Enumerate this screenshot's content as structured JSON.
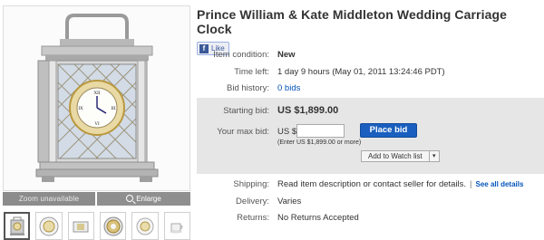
{
  "viewer": {
    "zoom_label": "Zoom unavailable",
    "enlarge_label": "Enlarge",
    "clock_numerals": [
      "XII",
      "III",
      "VI",
      "IX"
    ]
  },
  "listing": {
    "title": "Prince William & Kate Middleton Wedding Carriage Clock",
    "like_label": "Like",
    "condition_label": "Item condition:",
    "condition_value": "New",
    "time_left_label": "Time left:",
    "time_left_value": "1 day 9 hours (May 01, 2011 13:24:46 PDT)",
    "bid_history_label": "Bid history:",
    "bid_history_value": "0 bids"
  },
  "bidding": {
    "starting_bid_label": "Starting bid:",
    "starting_bid_value": "US $1,899.00",
    "max_bid_label": "Your max bid:",
    "currency_prefix": "US $",
    "max_bid_value": "",
    "place_bid_label": "Place bid",
    "enter_note": "(Enter US $1,899.00 or more)",
    "watch_label": "Add to Watch list",
    "watch_arrow": "▾"
  },
  "shipping": {
    "shipping_label": "Shipping:",
    "shipping_value": "Read item description or contact seller for details.",
    "separator": "|",
    "see_all_label": "See all details",
    "delivery_label": "Delivery:",
    "delivery_value": "Varies",
    "returns_label": "Returns:",
    "returns_value": "No Returns Accepted"
  },
  "colors": {
    "link": "#0654ba",
    "place_bid_bg": "#1a5fbf",
    "bid_box_bg": "#e6e6e6"
  }
}
